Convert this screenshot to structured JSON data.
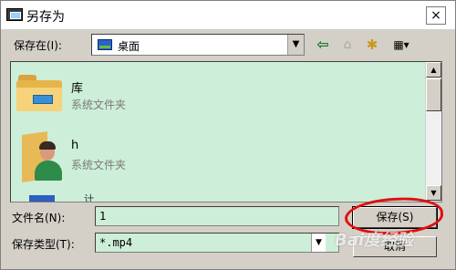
{
  "window": {
    "title": "另存为",
    "close": "×"
  },
  "toolbar": {
    "save_in_label": "保存在(I):",
    "location": "桌面",
    "combo_arrow": "▼",
    "back_glyph": "⇦",
    "up_glyph": "⌂",
    "new_folder_glyph": "✱",
    "view_glyph": "▦▾"
  },
  "files": [
    {
      "name": "库",
      "type": "系统文件夹",
      "icon": "library-folder-icon"
    },
    {
      "name": "h",
      "type": "系统文件夹",
      "icon": "user-folder-icon"
    }
  ],
  "partial_item": {
    "text": "计算机"
  },
  "scrollbar": {
    "up": "▲",
    "down": "▼"
  },
  "form": {
    "filename_label": "文件名(N):",
    "filename_value": "1",
    "filetype_label": "保存类型(T):",
    "filetype_value": "*.mp4",
    "filetype_arrow": "▼",
    "save_button": "保存(S)",
    "cancel_button": "取消"
  },
  "watermark": "Bai度经验",
  "colors": {
    "list_background": "#cdeed8",
    "highlight_circle": "#e01010"
  }
}
